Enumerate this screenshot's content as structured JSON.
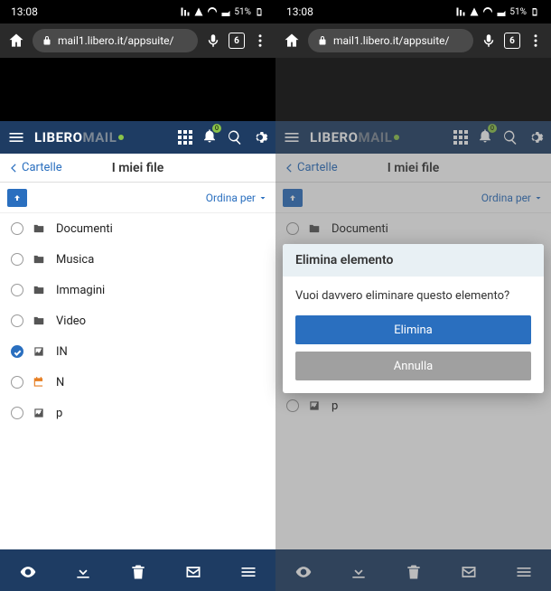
{
  "status": {
    "time": "13:08",
    "battery": "51%"
  },
  "browser": {
    "url": "mail1.libero.it/appsuite/",
    "tab_count": "6"
  },
  "logo": {
    "part1": "LIBERO",
    "part2": "MAIL"
  },
  "bell_badge": "0",
  "nav": {
    "back": "Cartelle",
    "title": "I miei file",
    "sort": "Ordina per"
  },
  "left_files": [
    {
      "icon": "folder",
      "name": "Documenti",
      "checked": false
    },
    {
      "icon": "folder",
      "name": "Musica",
      "checked": false
    },
    {
      "icon": "folder",
      "name": "Immagini",
      "checked": false
    },
    {
      "icon": "folder",
      "name": "Video",
      "checked": false
    },
    {
      "icon": "image",
      "name": "IN",
      "checked": true
    },
    {
      "icon": "cal",
      "name": "N",
      "checked": false
    },
    {
      "icon": "image",
      "name": "p",
      "checked": false
    }
  ],
  "right_files": [
    {
      "icon": "folder",
      "name": "Documenti",
      "checked": false
    },
    {
      "icon": "image",
      "name": "p",
      "checked": false
    }
  ],
  "modal": {
    "title": "Elimina elemento",
    "message": "Vuoi davvero eliminare questo elemento?",
    "confirm": "Elimina",
    "cancel": "Annulla"
  }
}
